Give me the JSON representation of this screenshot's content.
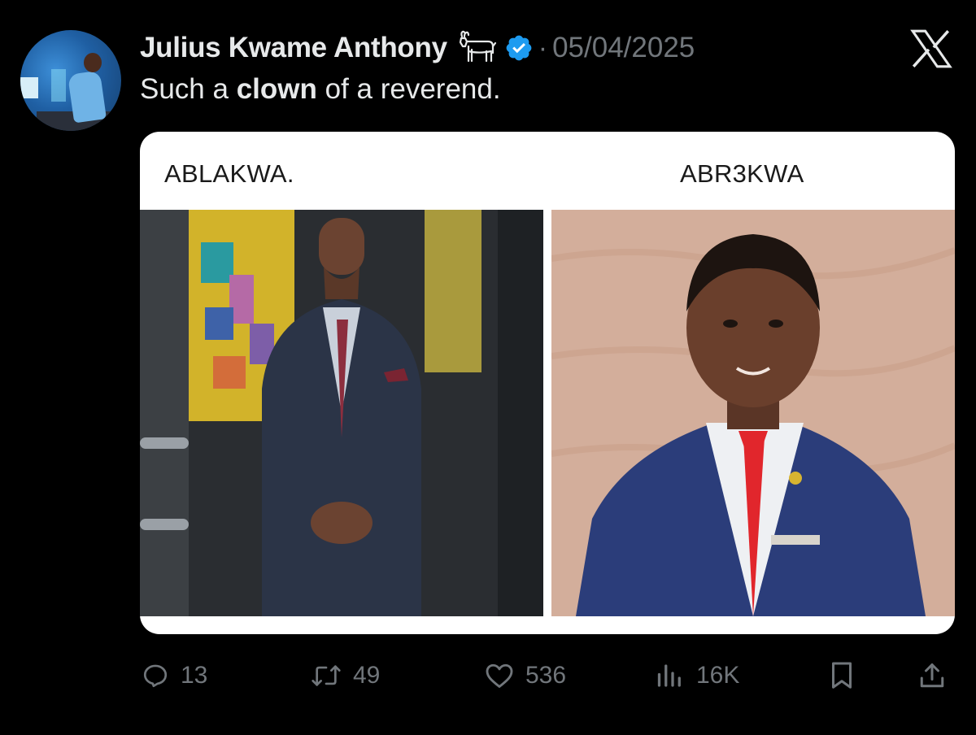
{
  "author": {
    "name": "Julius Kwame Anthony",
    "badge_icon": "goat-icon",
    "verified_icon": "verified-badge-icon",
    "separator": "·",
    "date": "05/04/2025"
  },
  "post": {
    "text_before": "Such a ",
    "text_bold": "clown",
    "text_after": " of a reverend."
  },
  "media": {
    "left_label": "ABLAKWA.",
    "right_label": "ABR3KWA"
  },
  "actions": {
    "replies": "13",
    "reposts": "49",
    "likes": "536",
    "views": "16K"
  },
  "colors": {
    "background": "#000000",
    "text": "#e7e9ea",
    "muted": "#71767b",
    "verified": "#1d9bf0"
  }
}
